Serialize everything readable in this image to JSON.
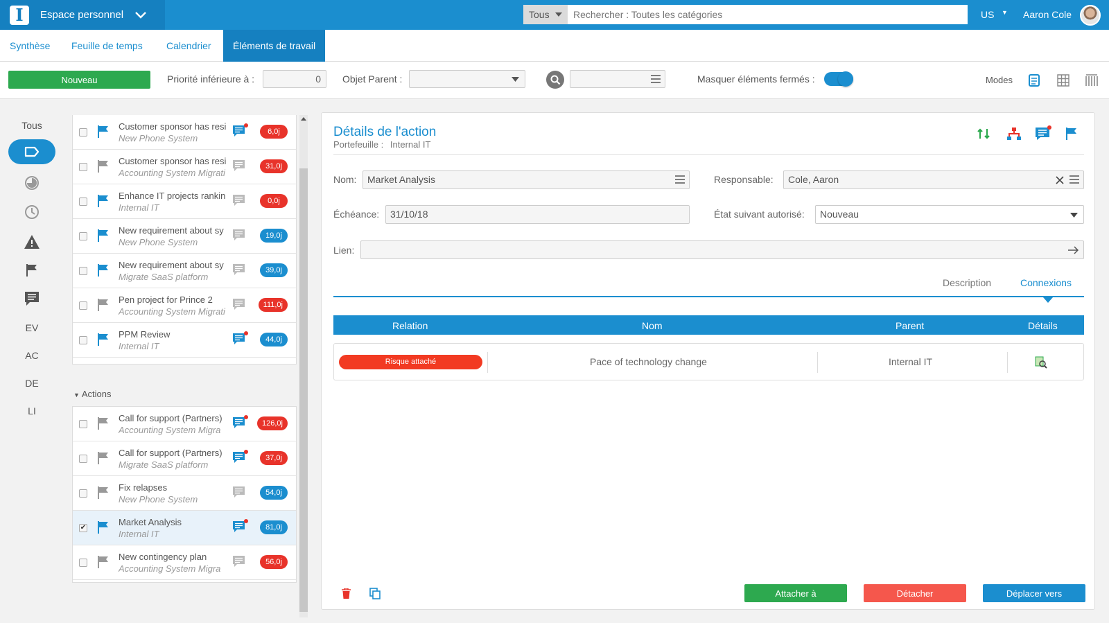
{
  "header": {
    "workspace": "Espace personnel",
    "search_category": "Tous",
    "search_placeholder": "Rechercher : Toutes les catégories",
    "language": "US",
    "user": "Aaron Cole"
  },
  "tabs": [
    {
      "label": "Synthèse",
      "active": false
    },
    {
      "label": "Feuille de temps",
      "active": false
    },
    {
      "label": "Calendrier",
      "active": false
    },
    {
      "label": "Éléments de travail",
      "active": true
    }
  ],
  "toolbar": {
    "new_button": "Nouveau",
    "priority_label": "Priorité inférieure à :",
    "priority_value": "0",
    "parent_label": "Objet Parent :",
    "hide_closed_label": "Masquer éléments fermés :",
    "hide_closed_on": true,
    "modes_label": "Modes"
  },
  "left_nav": {
    "all": "Tous",
    "labels": [
      "EV",
      "AC",
      "DE",
      "LI"
    ]
  },
  "list_top": [
    {
      "title": "Customer sponsor has resi",
      "sub": "New Phone System",
      "badge": "6,0j",
      "badge_color": "red",
      "flag": "blue",
      "comment": true
    },
    {
      "title": "Customer sponsor has resi",
      "sub": "Accounting System Migrati",
      "badge": "31,0j",
      "badge_color": "red",
      "flag": "grey",
      "comment": false
    },
    {
      "title": "Enhance IT projects rankin",
      "sub": "Internal IT",
      "badge": "0,0j",
      "badge_color": "red",
      "flag": "blue",
      "comment": false
    },
    {
      "title": "New requirement about sy",
      "sub": "New Phone System",
      "badge": "19,0j",
      "badge_color": "blue",
      "flag": "blue",
      "comment": false
    },
    {
      "title": "New requirement about sy",
      "sub": "Migrate SaaS platform",
      "badge": "39,0j",
      "badge_color": "blue",
      "flag": "blue",
      "comment": false
    },
    {
      "title": "Pen project for Prince 2",
      "sub": "Accounting System Migrati",
      "badge": "111,0j",
      "badge_color": "red",
      "flag": "grey",
      "comment": false
    },
    {
      "title": "PPM Review",
      "sub": "Internal IT",
      "badge": "44,0j",
      "badge_color": "blue",
      "flag": "blue",
      "comment": true
    }
  ],
  "actions_section": "Actions",
  "list_actions": [
    {
      "title": "Call for support (Partners)",
      "sub": "Accounting System Migra",
      "badge": "126,0j",
      "badge_color": "red",
      "flag": "grey",
      "comment": true,
      "checked": false
    },
    {
      "title": "Call for support (Partners)",
      "sub": "Migrate SaaS platform",
      "badge": "37,0j",
      "badge_color": "red",
      "flag": "grey",
      "comment": true,
      "checked": false
    },
    {
      "title": "Fix relapses",
      "sub": "New Phone System",
      "badge": "54,0j",
      "badge_color": "blue",
      "flag": "grey",
      "comment": false,
      "checked": false
    },
    {
      "title": "Market Analysis",
      "sub": "Internal IT",
      "badge": "81,0j",
      "badge_color": "blue",
      "flag": "blue",
      "comment": true,
      "checked": true
    },
    {
      "title": "New contingency plan",
      "sub": "Accounting System Migra",
      "badge": "56,0j",
      "badge_color": "red",
      "flag": "grey",
      "comment": false,
      "checked": false
    }
  ],
  "detail": {
    "title": "Détails de l'action",
    "portfolio_label": "Portefeuille :",
    "portfolio_value": "Internal IT",
    "name_label": "Nom:",
    "name_value": "Market Analysis",
    "owner_label": "Responsable:",
    "owner_value": "Cole, Aaron",
    "due_label": "Échéance:",
    "due_value": "31/10/18",
    "next_state_label": "État suivant autorisé:",
    "next_state_value": "Nouveau",
    "link_label": "Lien:",
    "tab_description": "Description",
    "tab_connections": "Connexions",
    "table_headers": [
      "Relation",
      "Nom",
      "Parent",
      "Détails"
    ],
    "rows": [
      {
        "relation": "Risque attaché",
        "name": "Pace of technology change",
        "parent": "Internal IT"
      }
    ],
    "btn_attach": "Attacher à",
    "btn_detach": "Détacher",
    "btn_move": "Déplacer vers"
  },
  "colors": {
    "primary": "#1b8ecf",
    "green": "#2da94f",
    "red": "#f23a22"
  }
}
